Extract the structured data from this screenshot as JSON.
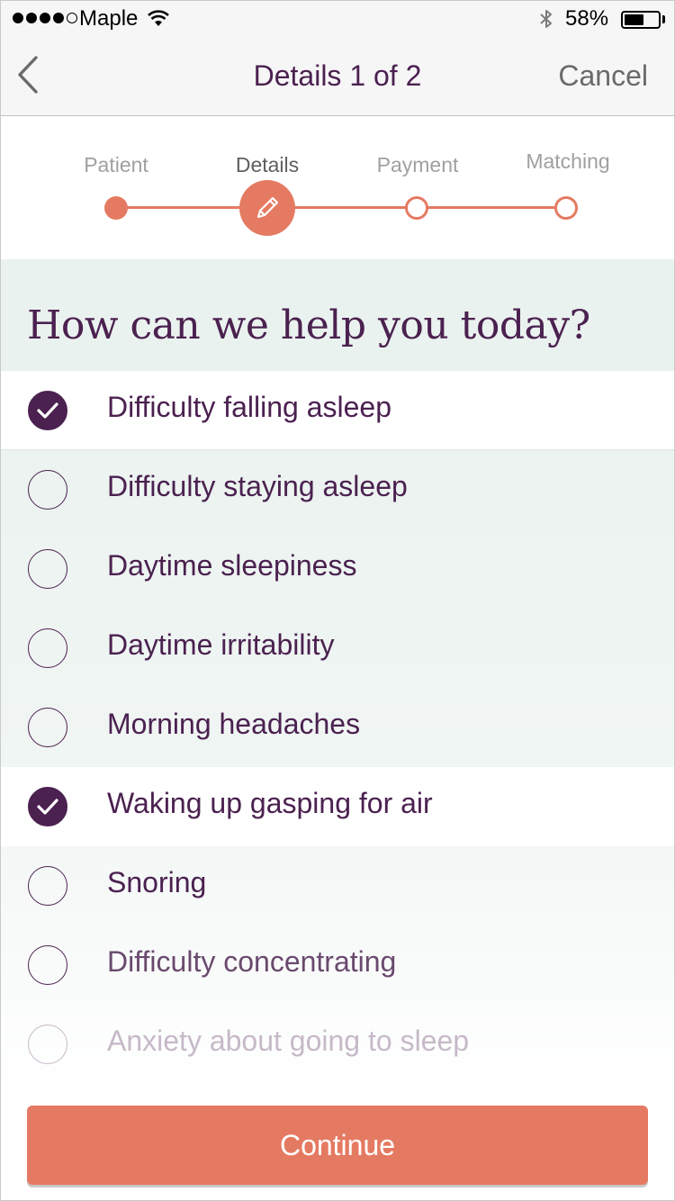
{
  "status_bar": {
    "carrier": "Maple",
    "battery_percent": "58%",
    "battery_level": 0.58
  },
  "nav": {
    "title": "Details 1 of 2",
    "cancel_label": "Cancel"
  },
  "stepper": {
    "steps": [
      {
        "label": "Patient",
        "state": "done"
      },
      {
        "label": "Details",
        "state": "current"
      },
      {
        "label": "Payment",
        "state": "todo"
      },
      {
        "label": "Matching",
        "state": "todo"
      }
    ]
  },
  "question": {
    "title": "How can we help you today?"
  },
  "options": [
    {
      "label": "Difficulty falling asleep",
      "checked": true
    },
    {
      "label": "Difficulty staying asleep",
      "checked": false
    },
    {
      "label": "Daytime sleepiness",
      "checked": false
    },
    {
      "label": "Daytime irritability",
      "checked": false
    },
    {
      "label": "Morning headaches",
      "checked": false
    },
    {
      "label": "Waking up gasping for air",
      "checked": true
    },
    {
      "label": "Snoring",
      "checked": false
    },
    {
      "label": "Difficulty concentrating",
      "checked": false
    },
    {
      "label": "Anxiety about going to sleep",
      "checked": false
    }
  ],
  "continue_label": "Continue",
  "colors": {
    "accent": "#e57a62",
    "primary_text": "#4b2150",
    "section_bg": "#eaf2ef"
  }
}
